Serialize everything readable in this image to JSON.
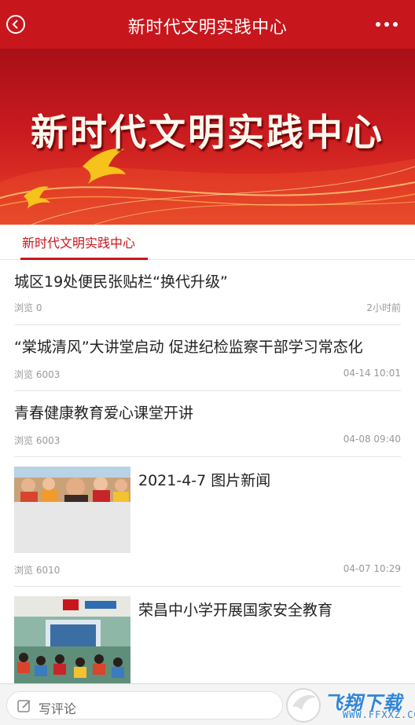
{
  "header": {
    "title": "新时代文明实践中心",
    "back_icon": "back-arrow-icon",
    "more_icon": "more-dots-icon",
    "bg_color": "#c8161d"
  },
  "banner": {
    "text": "新时代文明实践中心"
  },
  "tabs": [
    {
      "label": "新时代文明实践中心",
      "active": true
    }
  ],
  "news": [
    {
      "title": "城区19处便民张贴栏“换代升级”",
      "views": "浏览 0",
      "time": "2小时前"
    },
    {
      "title": "“棠城清风”大讲堂启动 促进纪检监察干部学习常态化",
      "views": "浏览 6003",
      "time": "04-14 10:01"
    },
    {
      "title": "青春健康教育爱心课堂开讲",
      "views": "浏览 6003",
      "time": "04-08 09:40"
    },
    {
      "title": "2021-4-7 图片新闻",
      "views": "浏览 6010",
      "time": "04-07 10:29"
    },
    {
      "title": "荣昌中小学开展国家安全教育"
    }
  ],
  "bottom": {
    "comment_placeholder": "写评论",
    "watermark_text": "飞翔下载",
    "watermark_url": "WWW.FFXXZ.COM"
  }
}
